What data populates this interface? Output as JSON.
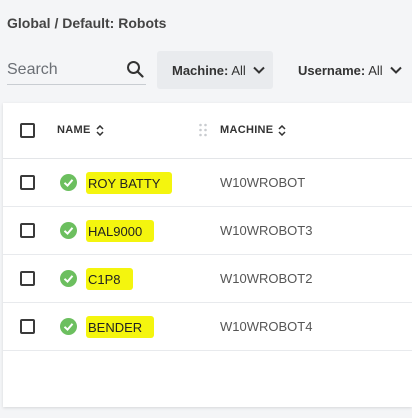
{
  "breadcrumb": "Global / Default: Robots",
  "search": {
    "placeholder": "Search",
    "value": ""
  },
  "filters": [
    {
      "key": "Machine:",
      "value": "All"
    },
    {
      "key": "Username:",
      "value": "All"
    }
  ],
  "table": {
    "columns": [
      "NAME",
      "MACHINE"
    ],
    "rows": [
      {
        "name": "ROY BATTY",
        "machine": "W10WROBOT",
        "status": "connected"
      },
      {
        "name": "HAL9000",
        "machine": "W10WROBOT3",
        "status": "connected"
      },
      {
        "name": "C1P8",
        "machine": "W10WROBOT2",
        "status": "connected"
      },
      {
        "name": "BENDER",
        "machine": "W10WROBOT4",
        "status": "connected"
      }
    ]
  },
  "colors": {
    "status_ok": "#6cbf5f",
    "highlight": "#f4f50e",
    "filter_bg": "#e9ebee"
  },
  "icons": {
    "search": "search-icon",
    "chevron": "chevron-down-icon",
    "sort": "sort-icon",
    "status": "check-circle-icon",
    "drag": "drag-handle-icon"
  }
}
